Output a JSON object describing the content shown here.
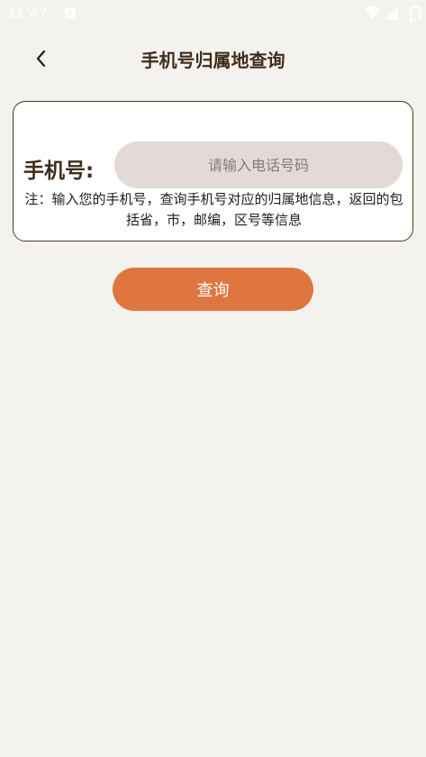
{
  "status_bar": {
    "time": "11:47"
  },
  "header": {
    "title": "手机号归属地查询",
    "back_icon": "chevron-left-icon"
  },
  "form": {
    "label": "手机号:",
    "input_value": "",
    "input_placeholder": "请输入电话号码",
    "note": "注：输入您的手机号，查询手机号对应的归属地信息，返回的包括省，市，邮编，区号等信息"
  },
  "actions": {
    "query_label": "查询"
  },
  "colors": {
    "background": "#f4f2ee",
    "accent": "#df7640",
    "input_bg": "#e3d9d6",
    "title_text": "#3f2d1b",
    "card_border": "#4a3a26"
  }
}
